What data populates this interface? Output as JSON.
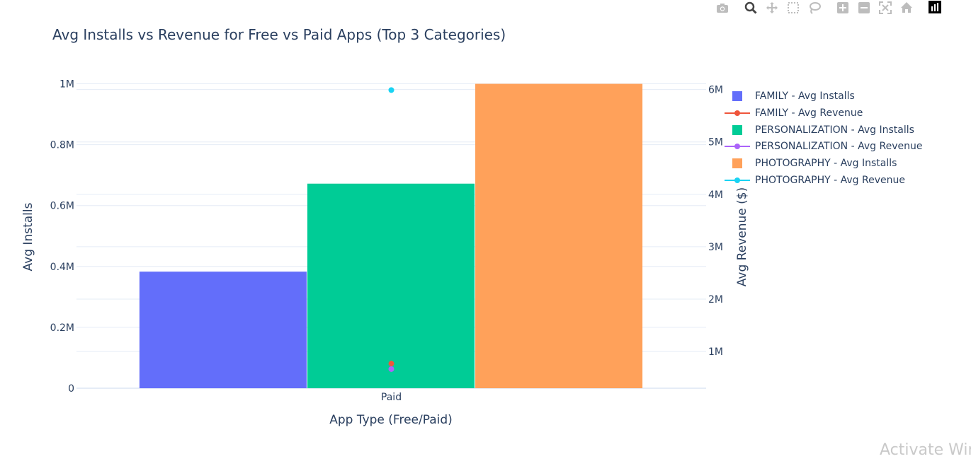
{
  "modebar": {
    "icons": [
      "camera-icon",
      "zoom-icon",
      "pan-icon",
      "box-select-icon",
      "lasso-icon",
      "zoom-in-icon",
      "zoom-out-icon",
      "autoscale-icon",
      "reset-axes-icon",
      "plotly-logo-icon"
    ]
  },
  "watermark": "Activate Wir",
  "chart_data": {
    "type": "bar",
    "title": "Avg Installs vs Revenue for Free vs Paid Apps (Top 3 Categories)",
    "xlabel": "App Type (Free/Paid)",
    "ylabel": "Avg Installs",
    "y2label": "Avg Revenue ($)",
    "categories": [
      "Paid"
    ],
    "ylim": [
      0,
      1050000
    ],
    "y2lim": [
      300000,
      6400000
    ],
    "yticks": [
      0,
      200000,
      400000,
      600000,
      800000,
      1000000
    ],
    "yticklabels": [
      "0",
      "0.2M",
      "0.4M",
      "0.6M",
      "0.8M",
      "1M"
    ],
    "y2ticks": [
      1000000,
      2000000,
      3000000,
      4000000,
      5000000,
      6000000
    ],
    "y2ticklabels": [
      "1M",
      "2M",
      "3M",
      "4M",
      "5M",
      "6M"
    ],
    "grid": true,
    "legend_position": "right",
    "series": [
      {
        "name": "FAMILY - Avg Installs",
        "kind": "bar",
        "axis": "y",
        "color": "#636efa",
        "values": [
          383000
        ]
      },
      {
        "name": "FAMILY - Avg Revenue",
        "kind": "line+markers",
        "axis": "y2",
        "color": "#ef553b",
        "values": [
          770000
        ]
      },
      {
        "name": "PERSONALIZATION - Avg Installs",
        "kind": "bar",
        "axis": "y",
        "color": "#00cc96",
        "values": [
          672000
        ]
      },
      {
        "name": "PERSONALIZATION - Avg Revenue",
        "kind": "line+markers",
        "axis": "y2",
        "color": "#ab63fa",
        "values": [
          665000
        ]
      },
      {
        "name": "PHOTOGRAPHY - Avg Installs",
        "kind": "bar",
        "axis": "y",
        "color": "#ffa15a",
        "values": [
          1000000
        ]
      },
      {
        "name": "PHOTOGRAPHY - Avg Revenue",
        "kind": "line+markers",
        "axis": "y2",
        "color": "#19d3f3",
        "values": [
          5990000
        ]
      }
    ]
  }
}
